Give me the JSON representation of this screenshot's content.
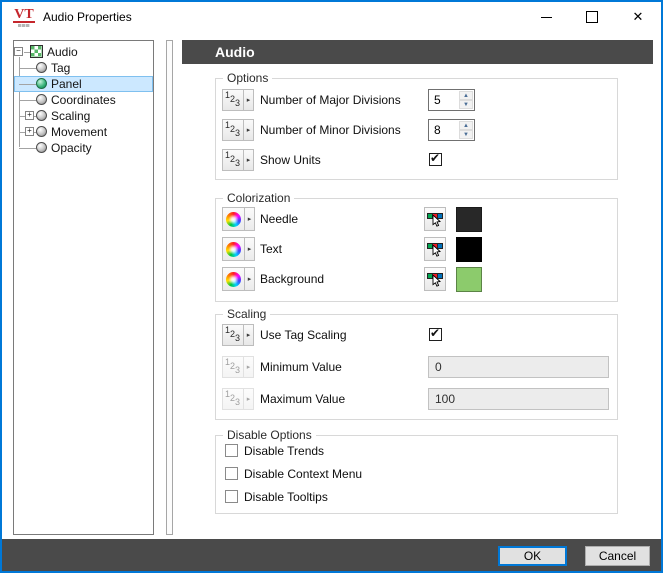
{
  "window": {
    "title": "Audio Properties",
    "logo_text": "VT",
    "accent_color": "#0078d7",
    "chrome_color": "#4a4a4a"
  },
  "icons": {
    "close": "✕",
    "check": "✔",
    "plus": "+",
    "minus": "−",
    "spin_up": "▲",
    "spin_down": "▼",
    "dropdown": "▸",
    "digit1": "1",
    "digit2": "2",
    "digit3": "3"
  },
  "tree": {
    "root": {
      "label": "Audio",
      "icon": "checker-icon",
      "expanded": true
    },
    "items": [
      {
        "label": "Tag",
        "icon": "gray-ball-icon",
        "selected": false
      },
      {
        "label": "Panel",
        "icon": "green-ball-icon",
        "selected": true
      },
      {
        "label": "Coordinates",
        "icon": "gray-ball-icon",
        "selected": false
      },
      {
        "label": "Scaling",
        "icon": "gray-ball-icon",
        "selected": false,
        "collapsed": true
      },
      {
        "label": "Movement",
        "icon": "gray-ball-icon",
        "selected": false,
        "collapsed": true
      },
      {
        "label": "Opacity",
        "icon": "gray-ball-icon",
        "selected": false
      }
    ]
  },
  "content": {
    "header": "Audio",
    "groups": {
      "options": {
        "title": "Options",
        "rows": [
          {
            "label": "Number of Major Divisions",
            "value": "5",
            "control": "spinner"
          },
          {
            "label": "Number of Minor Divisions",
            "value": "8",
            "control": "spinner"
          },
          {
            "label": "Show Units",
            "checked": true,
            "control": "checkbox"
          }
        ]
      },
      "colorization": {
        "title": "Colorization",
        "rows": [
          {
            "label": "Needle",
            "color": "#282828"
          },
          {
            "label": "Text",
            "color": "#000000"
          },
          {
            "label": "Background",
            "color": "#8ccb6c"
          }
        ]
      },
      "scaling": {
        "title": "Scaling",
        "rows": [
          {
            "label": "Use Tag Scaling",
            "checked": true,
            "control": "checkbox"
          },
          {
            "label": "Minimum Value",
            "value": "0",
            "control": "textbox",
            "disabled": true
          },
          {
            "label": "Maximum Value",
            "value": "100",
            "control": "textbox",
            "disabled": true
          }
        ]
      },
      "disable_options": {
        "title": "Disable Options",
        "rows": [
          {
            "label": "Disable Trends",
            "checked": false
          },
          {
            "label": "Disable Context Menu",
            "checked": false
          },
          {
            "label": "Disable Tooltips",
            "checked": false
          }
        ]
      }
    }
  },
  "footer": {
    "ok_label": "OK",
    "cancel_label": "Cancel"
  }
}
